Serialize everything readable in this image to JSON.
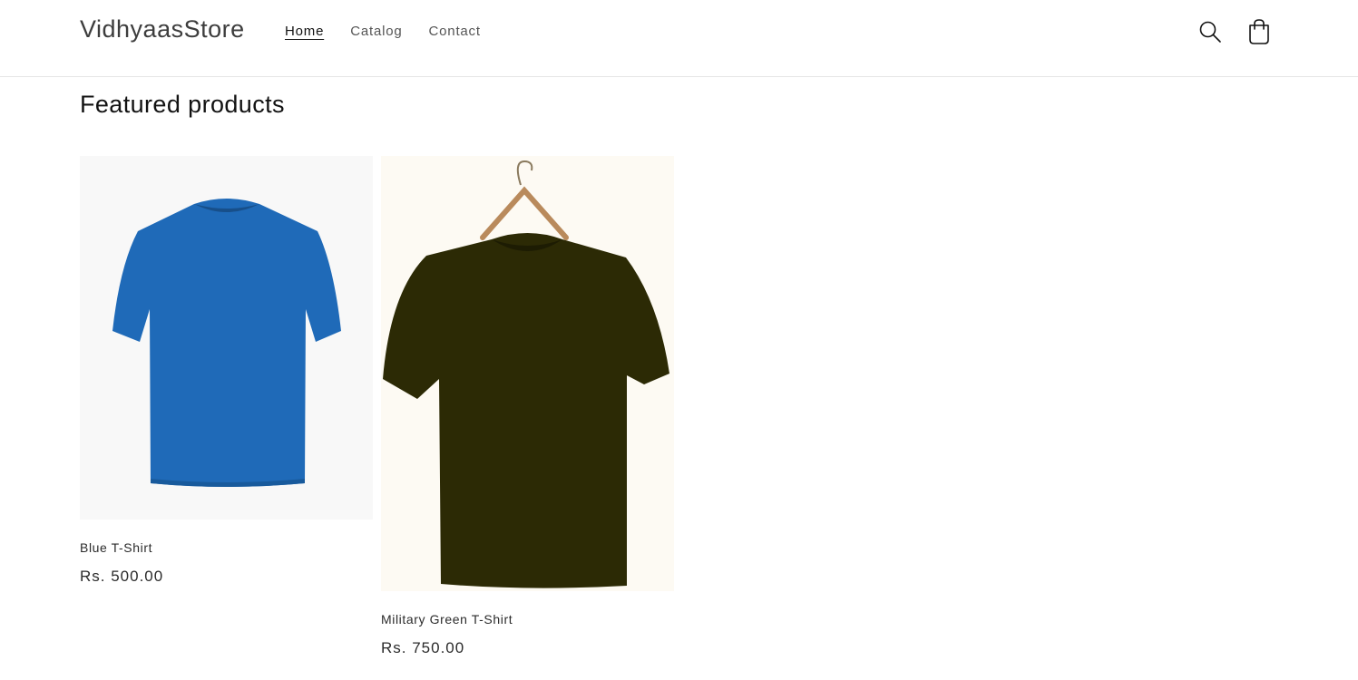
{
  "header": {
    "logo": "VidhyaasStore",
    "nav": [
      {
        "label": "Home",
        "active": true
      },
      {
        "label": "Catalog",
        "active": false
      },
      {
        "label": "Contact",
        "active": false
      }
    ],
    "icons": [
      "search-icon",
      "cart-icon"
    ]
  },
  "main": {
    "section_title": "Featured products",
    "products": [
      {
        "title": "Blue T-Shirt",
        "price": "Rs. 500.00",
        "color": "#1f6ab8"
      },
      {
        "title": "Military Green T-Shirt",
        "price": "Rs. 750.00",
        "color": "#2c2a05"
      }
    ]
  }
}
